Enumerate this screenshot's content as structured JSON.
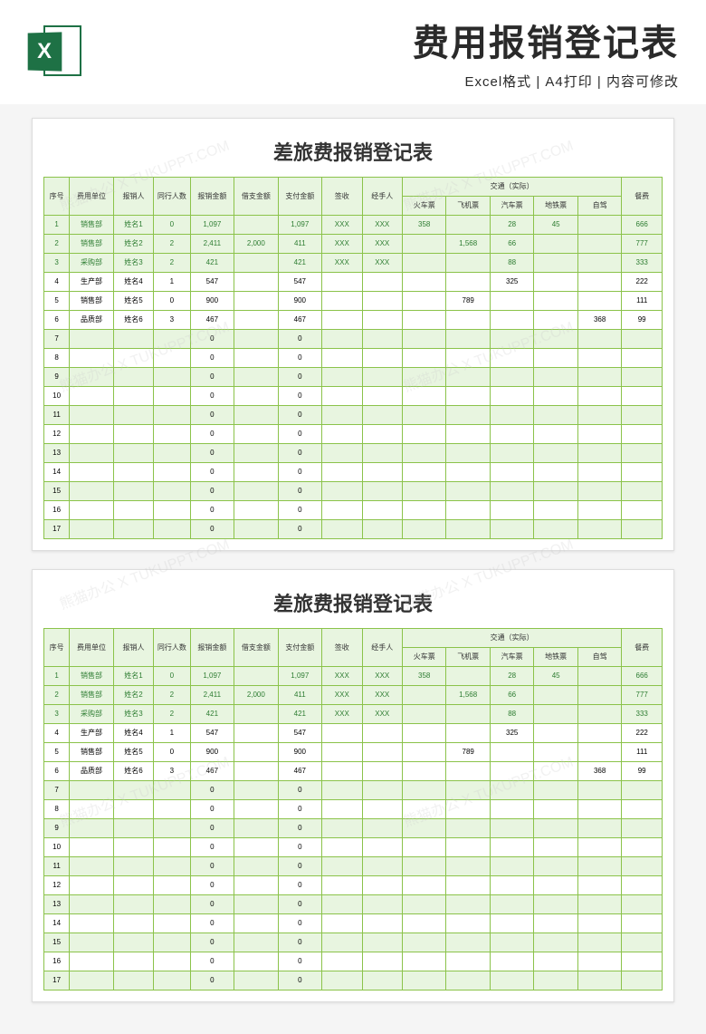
{
  "header": {
    "icon_letter": "X",
    "title": "费用报销登记表",
    "subtitle": "Excel格式 | A4打印 | 内容可修改"
  },
  "sheet_title": "差旅费报销登记表",
  "columns": {
    "seq": "序号",
    "dept": "费用单位",
    "person": "报销人",
    "companions": "同行人数",
    "amount": "报销金额",
    "advance": "借支金额",
    "pay": "支付金额",
    "sign": "签收",
    "handler": "经手人",
    "transport_group": "交通（实际）",
    "train": "火车票",
    "plane": "飞机票",
    "bus": "汽车票",
    "subway": "地铁票",
    "self": "自驾",
    "meal": "餐费"
  },
  "rows": [
    {
      "seq": "1",
      "dept": "销售部",
      "person": "姓名1",
      "companions": "0",
      "amount": "1,097",
      "advance": "",
      "pay": "1,097",
      "sign": "XXX",
      "handler": "XXX",
      "train": "358",
      "plane": "",
      "bus": "28",
      "subway": "45",
      "self": "",
      "meal": "666",
      "hl": true
    },
    {
      "seq": "2",
      "dept": "销售部",
      "person": "姓名2",
      "companions": "2",
      "amount": "2,411",
      "advance": "2,000",
      "pay": "411",
      "sign": "XXX",
      "handler": "XXX",
      "train": "",
      "plane": "1,568",
      "bus": "66",
      "subway": "",
      "self": "",
      "meal": "777",
      "hl": true
    },
    {
      "seq": "3",
      "dept": "采购部",
      "person": "姓名3",
      "companions": "2",
      "amount": "421",
      "advance": "",
      "pay": "421",
      "sign": "XXX",
      "handler": "XXX",
      "train": "",
      "plane": "",
      "bus": "88",
      "subway": "",
      "self": "",
      "meal": "333",
      "hl": true
    },
    {
      "seq": "4",
      "dept": "生产部",
      "person": "姓名4",
      "companions": "1",
      "amount": "547",
      "advance": "",
      "pay": "547",
      "sign": "",
      "handler": "",
      "train": "",
      "plane": "",
      "bus": "325",
      "subway": "",
      "self": "",
      "meal": "222",
      "hl": false
    },
    {
      "seq": "5",
      "dept": "销售部",
      "person": "姓名5",
      "companions": "0",
      "amount": "900",
      "advance": "",
      "pay": "900",
      "sign": "",
      "handler": "",
      "train": "",
      "plane": "789",
      "bus": "",
      "subway": "",
      "self": "",
      "meal": "111",
      "hl": false
    },
    {
      "seq": "6",
      "dept": "品质部",
      "person": "姓名6",
      "companions": "3",
      "amount": "467",
      "advance": "",
      "pay": "467",
      "sign": "",
      "handler": "",
      "train": "",
      "plane": "",
      "bus": "",
      "subway": "",
      "self": "368",
      "meal": "99",
      "hl": false
    },
    {
      "seq": "7",
      "dept": "",
      "person": "",
      "companions": "",
      "amount": "0",
      "advance": "",
      "pay": "0",
      "sign": "",
      "handler": "",
      "train": "",
      "plane": "",
      "bus": "",
      "subway": "",
      "self": "",
      "meal": "",
      "hl": false,
      "empty": true
    },
    {
      "seq": "8",
      "dept": "",
      "person": "",
      "companions": "",
      "amount": "0",
      "advance": "",
      "pay": "0",
      "sign": "",
      "handler": "",
      "train": "",
      "plane": "",
      "bus": "",
      "subway": "",
      "self": "",
      "meal": "",
      "hl": false,
      "empty": true
    },
    {
      "seq": "9",
      "dept": "",
      "person": "",
      "companions": "",
      "amount": "0",
      "advance": "",
      "pay": "0",
      "sign": "",
      "handler": "",
      "train": "",
      "plane": "",
      "bus": "",
      "subway": "",
      "self": "",
      "meal": "",
      "hl": false,
      "empty": true
    },
    {
      "seq": "10",
      "dept": "",
      "person": "",
      "companions": "",
      "amount": "0",
      "advance": "",
      "pay": "0",
      "sign": "",
      "handler": "",
      "train": "",
      "plane": "",
      "bus": "",
      "subway": "",
      "self": "",
      "meal": "",
      "hl": false,
      "empty": true
    },
    {
      "seq": "11",
      "dept": "",
      "person": "",
      "companions": "",
      "amount": "0",
      "advance": "",
      "pay": "0",
      "sign": "",
      "handler": "",
      "train": "",
      "plane": "",
      "bus": "",
      "subway": "",
      "self": "",
      "meal": "",
      "hl": false,
      "empty": true
    },
    {
      "seq": "12",
      "dept": "",
      "person": "",
      "companions": "",
      "amount": "0",
      "advance": "",
      "pay": "0",
      "sign": "",
      "handler": "",
      "train": "",
      "plane": "",
      "bus": "",
      "subway": "",
      "self": "",
      "meal": "",
      "hl": false,
      "empty": true
    },
    {
      "seq": "13",
      "dept": "",
      "person": "",
      "companions": "",
      "amount": "0",
      "advance": "",
      "pay": "0",
      "sign": "",
      "handler": "",
      "train": "",
      "plane": "",
      "bus": "",
      "subway": "",
      "self": "",
      "meal": "",
      "hl": false,
      "empty": true
    },
    {
      "seq": "14",
      "dept": "",
      "person": "",
      "companions": "",
      "amount": "0",
      "advance": "",
      "pay": "0",
      "sign": "",
      "handler": "",
      "train": "",
      "plane": "",
      "bus": "",
      "subway": "",
      "self": "",
      "meal": "",
      "hl": false,
      "empty": true
    },
    {
      "seq": "15",
      "dept": "",
      "person": "",
      "companions": "",
      "amount": "0",
      "advance": "",
      "pay": "0",
      "sign": "",
      "handler": "",
      "train": "",
      "plane": "",
      "bus": "",
      "subway": "",
      "self": "",
      "meal": "",
      "hl": false,
      "empty": true
    },
    {
      "seq": "16",
      "dept": "",
      "person": "",
      "companions": "",
      "amount": "0",
      "advance": "",
      "pay": "0",
      "sign": "",
      "handler": "",
      "train": "",
      "plane": "",
      "bus": "",
      "subway": "",
      "self": "",
      "meal": "",
      "hl": false,
      "empty": true
    },
    {
      "seq": "17",
      "dept": "",
      "person": "",
      "companions": "",
      "amount": "0",
      "advance": "",
      "pay": "0",
      "sign": "",
      "handler": "",
      "train": "",
      "plane": "",
      "bus": "",
      "subway": "",
      "self": "",
      "meal": "",
      "hl": false,
      "empty": true
    }
  ],
  "watermark": "熊猫办公 X TUKUPPT.COM"
}
